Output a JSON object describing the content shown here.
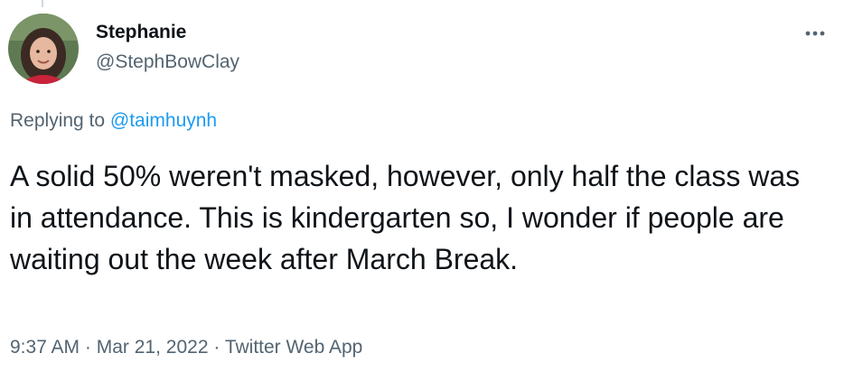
{
  "tweet": {
    "author_name": "Stephanie",
    "author_handle": "@StephBowClay",
    "more_icon": "more-horizontal-icon",
    "replying_prefix": "Replying to",
    "replying_to": "@taimhuynh",
    "text": "A solid 50% weren't masked, however, only half the class was in attendance. This is kindergarten so, I wonder if people are waiting out the week after March Break.",
    "time": "9:37 AM",
    "separator": "·",
    "date": "Mar 21, 2022",
    "source": "Twitter Web App"
  },
  "colors": {
    "text": "#0f1419",
    "secondary": "#536471",
    "link": "#1d9bf0"
  }
}
